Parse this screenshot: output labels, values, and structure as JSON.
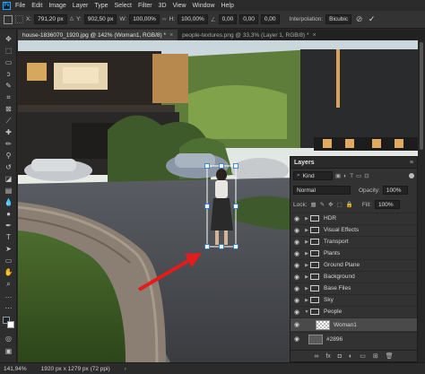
{
  "menu": [
    "File",
    "Edit",
    "Image",
    "Layer",
    "Type",
    "Select",
    "Filter",
    "3D",
    "View",
    "Window",
    "Help"
  ],
  "options": {
    "x_label": "X:",
    "x_value": "791,20 px",
    "y_label": "Y:",
    "y_value": "902,50 px",
    "w_label": "W:",
    "w_value": "100,00%",
    "h_label": "H:",
    "h_value": "100,00%",
    "angle_value": "0,00",
    "h2_value": "0,00",
    "v_value": "0,00",
    "interp_label": "Interpolation:",
    "interp_value": "Bicubic"
  },
  "tabs": [
    {
      "label": "house-1836070_1920.jpg @ 142% (Woman1, RGB/8) *",
      "active": true
    },
    {
      "label": "people-textures.png @ 33,3% (Layer 1, RGB/8) *",
      "active": false
    }
  ],
  "status": {
    "zoom": "141,94%",
    "doc_size": "1920 px x 1279 px (72 ppi)"
  },
  "layers": {
    "title": "Layers",
    "filter_kind": "Kind",
    "blend_mode": "Normal",
    "opacity_label": "Opacity:",
    "opacity_value": "100%",
    "lock_label": "Lock:",
    "fill_label": "Fill:",
    "fill_value": "100%",
    "items": [
      {
        "name": "HDR",
        "type": "group"
      },
      {
        "name": "Visual Effects",
        "type": "group"
      },
      {
        "name": "Transport",
        "type": "group"
      },
      {
        "name": "Plants",
        "type": "group"
      },
      {
        "name": "Ground Plane",
        "type": "group"
      },
      {
        "name": "Background",
        "type": "group"
      },
      {
        "name": "Base Files",
        "type": "group"
      },
      {
        "name": "Sky",
        "type": "group"
      },
      {
        "name": "People",
        "type": "group-open"
      },
      {
        "name": "Woman1",
        "type": "layer",
        "selected": true
      },
      {
        "name": "#2896",
        "type": "layer"
      }
    ]
  },
  "colors": {
    "accent_arrow": "#e21b1b",
    "ps_blue": "#31a8ff",
    "transform_box": "#ffffff"
  }
}
